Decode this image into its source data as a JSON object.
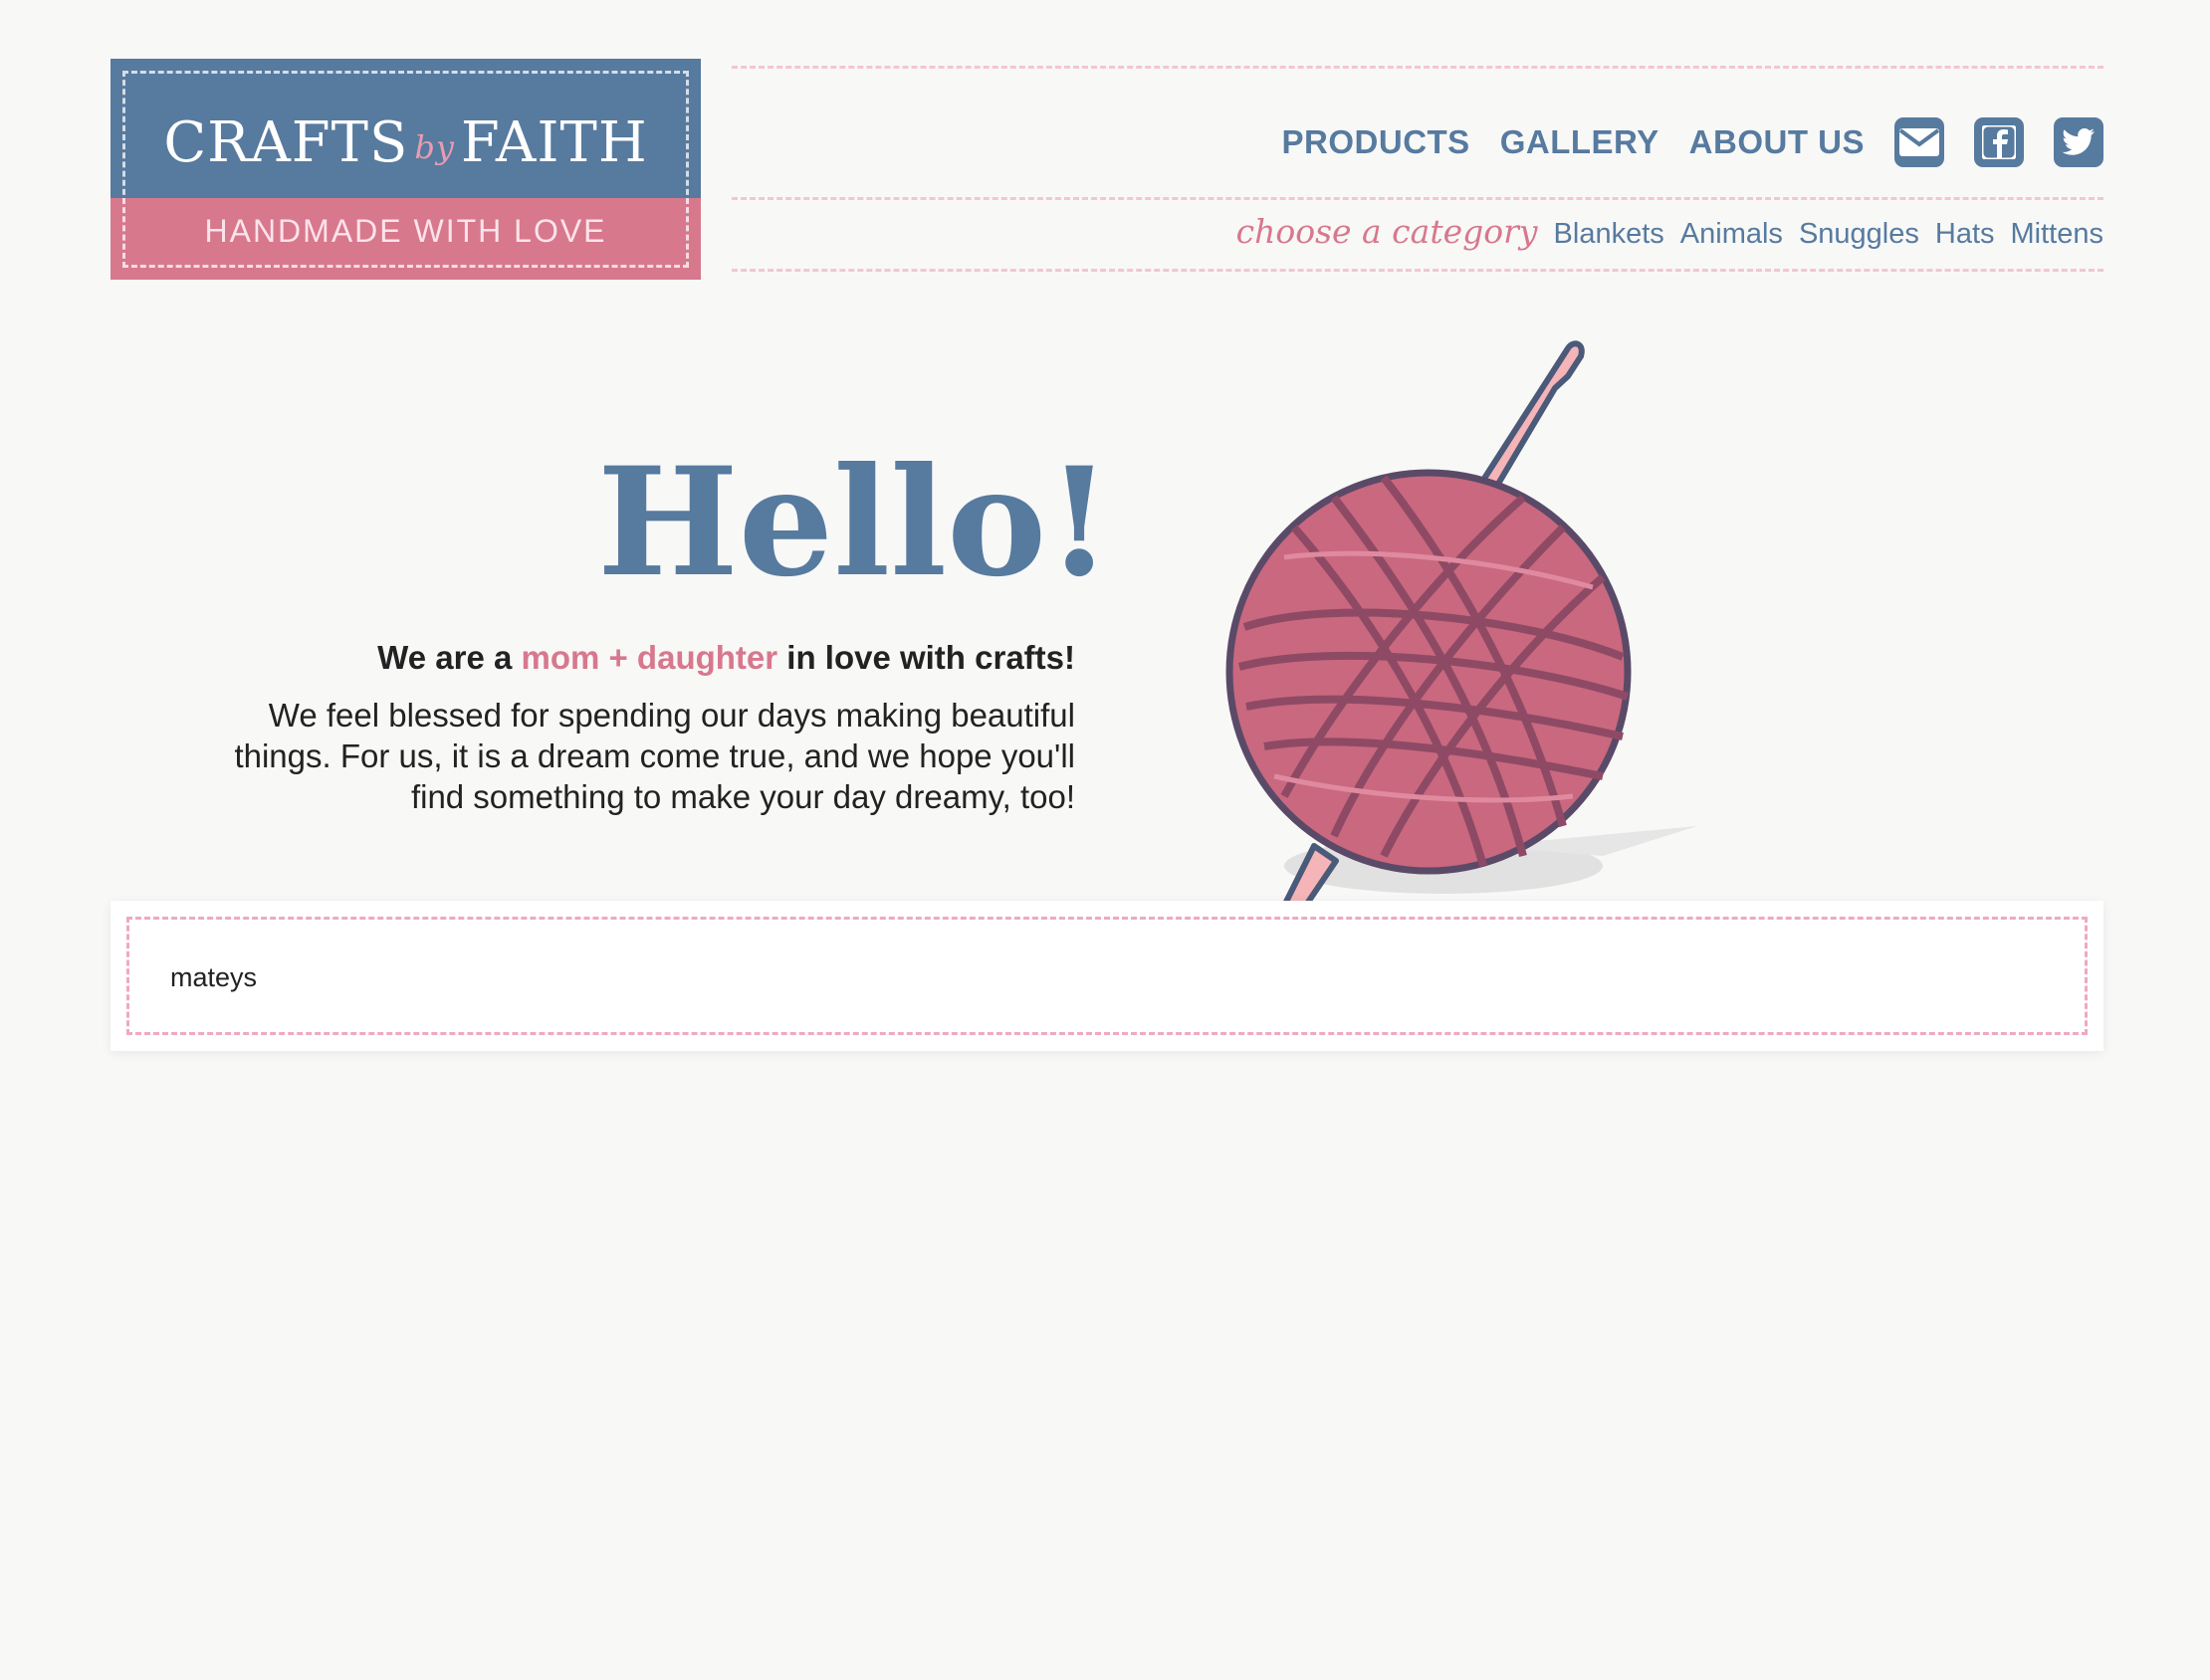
{
  "logo": {
    "title_left": "CRAFTS",
    "title_by": "by",
    "title_right": "FAITH",
    "subtitle": "HANDMADE WITH LOVE"
  },
  "nav": {
    "items": [
      "PRODUCTS",
      "GALLERY",
      "ABOUT US"
    ],
    "icons": [
      "mail-icon",
      "facebook-icon",
      "twitter-icon"
    ]
  },
  "categories": {
    "label": "choose a category",
    "items": [
      "Blankets",
      "Animals",
      "Snuggles",
      "Hats",
      "Mittens"
    ]
  },
  "hero": {
    "heading": "Hello!",
    "tagline_pre": "We are a ",
    "tagline_highlight": "mom + daughter",
    "tagline_post": " in love with crafts!",
    "intro_line1": "We feel blessed for spending our days making beautiful",
    "intro_line2": "things. For us, it is a dream come true, and we hope you'll",
    "intro_line3": "find something to make your day dreamy, too!"
  },
  "card": {
    "text": "mateys"
  },
  "colors": {
    "blue": "#577a9f",
    "pink": "#d7788d",
    "yarn": "#c9687f",
    "background": "#f8f8f7"
  }
}
